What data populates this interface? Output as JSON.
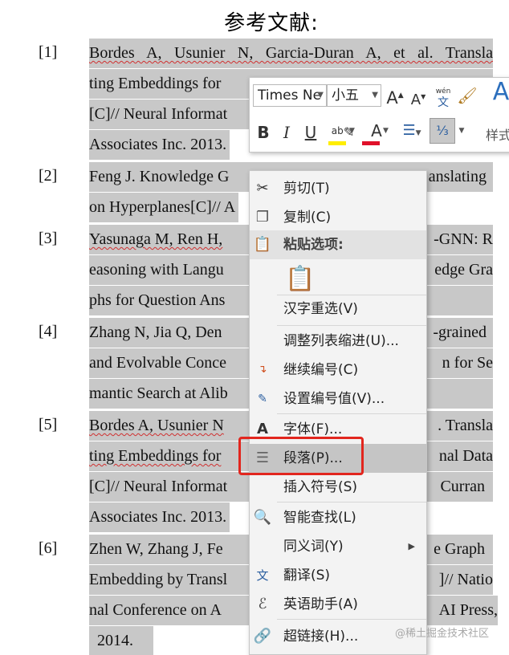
{
  "document": {
    "title": "参考文献:",
    "references": [
      {
        "num": "[1]",
        "lines": [
          "Bordes A, Usunier N, Garcia-Duran A, et al. Transla",
          "ting Embeddings for",
          "[C]// Neural Informat",
          "Associates Inc. 2013."
        ]
      },
      {
        "num": "[2]",
        "lines": [
          "Feng J. Knowledge G",
          "on Hyperplanes[C]// A",
          "anslating"
        ]
      },
      {
        "num": "[3]",
        "lines": [
          "Yasunaga M, Ren H,",
          "easoning with Langu",
          "phs for Question Ans",
          "-GNN: R",
          "edge Gra"
        ]
      },
      {
        "num": "[4]",
        "lines": [
          "Zhang N, Jia Q, Den",
          "and Evolvable Conce",
          "mantic Search at Alib",
          "-grained",
          "n for Se"
        ]
      },
      {
        "num": "[5]",
        "lines": [
          "Bordes A, Usunier N",
          "ting Embeddings for",
          "[C]// Neural Informat",
          "Associates Inc. 2013.",
          ". Transla",
          "nal Data",
          "Curran"
        ]
      },
      {
        "num": "[6]",
        "lines": [
          "Zhen W, Zhang J, Fe",
          "Embedding by Transl",
          "nal Conference on A",
          "2014.",
          "e Graph",
          "]// Natio",
          "AI Press,"
        ]
      }
    ]
  },
  "mini_toolbar": {
    "font_name": "Times Ne",
    "font_size": "小五",
    "styles_label": "样式"
  },
  "context_menu": {
    "items": [
      {
        "label": "剪切(T)",
        "icon": "scissors-icon"
      },
      {
        "label": "复制(C)",
        "icon": "copy-icon"
      },
      {
        "label": "粘贴选项:",
        "icon": "paste-icon"
      },
      {
        "label": "汉字重选(V)"
      },
      {
        "label": "调整列表缩进(U)..."
      },
      {
        "label": "继续编号(C)",
        "icon": "continue-numbering-icon"
      },
      {
        "label": "设置编号值(V)...",
        "icon": "set-numbering-value-icon"
      },
      {
        "label": "字体(F)...",
        "icon": "font-icon"
      },
      {
        "label": "段落(P)...",
        "icon": "paragraph-icon"
      },
      {
        "label": "插入符号(S)"
      },
      {
        "label": "智能查找(L)",
        "icon": "smart-lookup-icon"
      },
      {
        "label": "同义词(Y)"
      },
      {
        "label": "翻译(S)",
        "icon": "translate-icon"
      },
      {
        "label": "英语助手(A)",
        "icon": "english-assistant-icon"
      },
      {
        "label": "超链接(H)...",
        "icon": "hyperlink-icon"
      }
    ]
  },
  "watermark": "@稀土掘金技术社区",
  "colors": {
    "selection": "#c8c8c8",
    "highlight_box": "#e2261e",
    "menu_hover": "#c5c5c5"
  }
}
